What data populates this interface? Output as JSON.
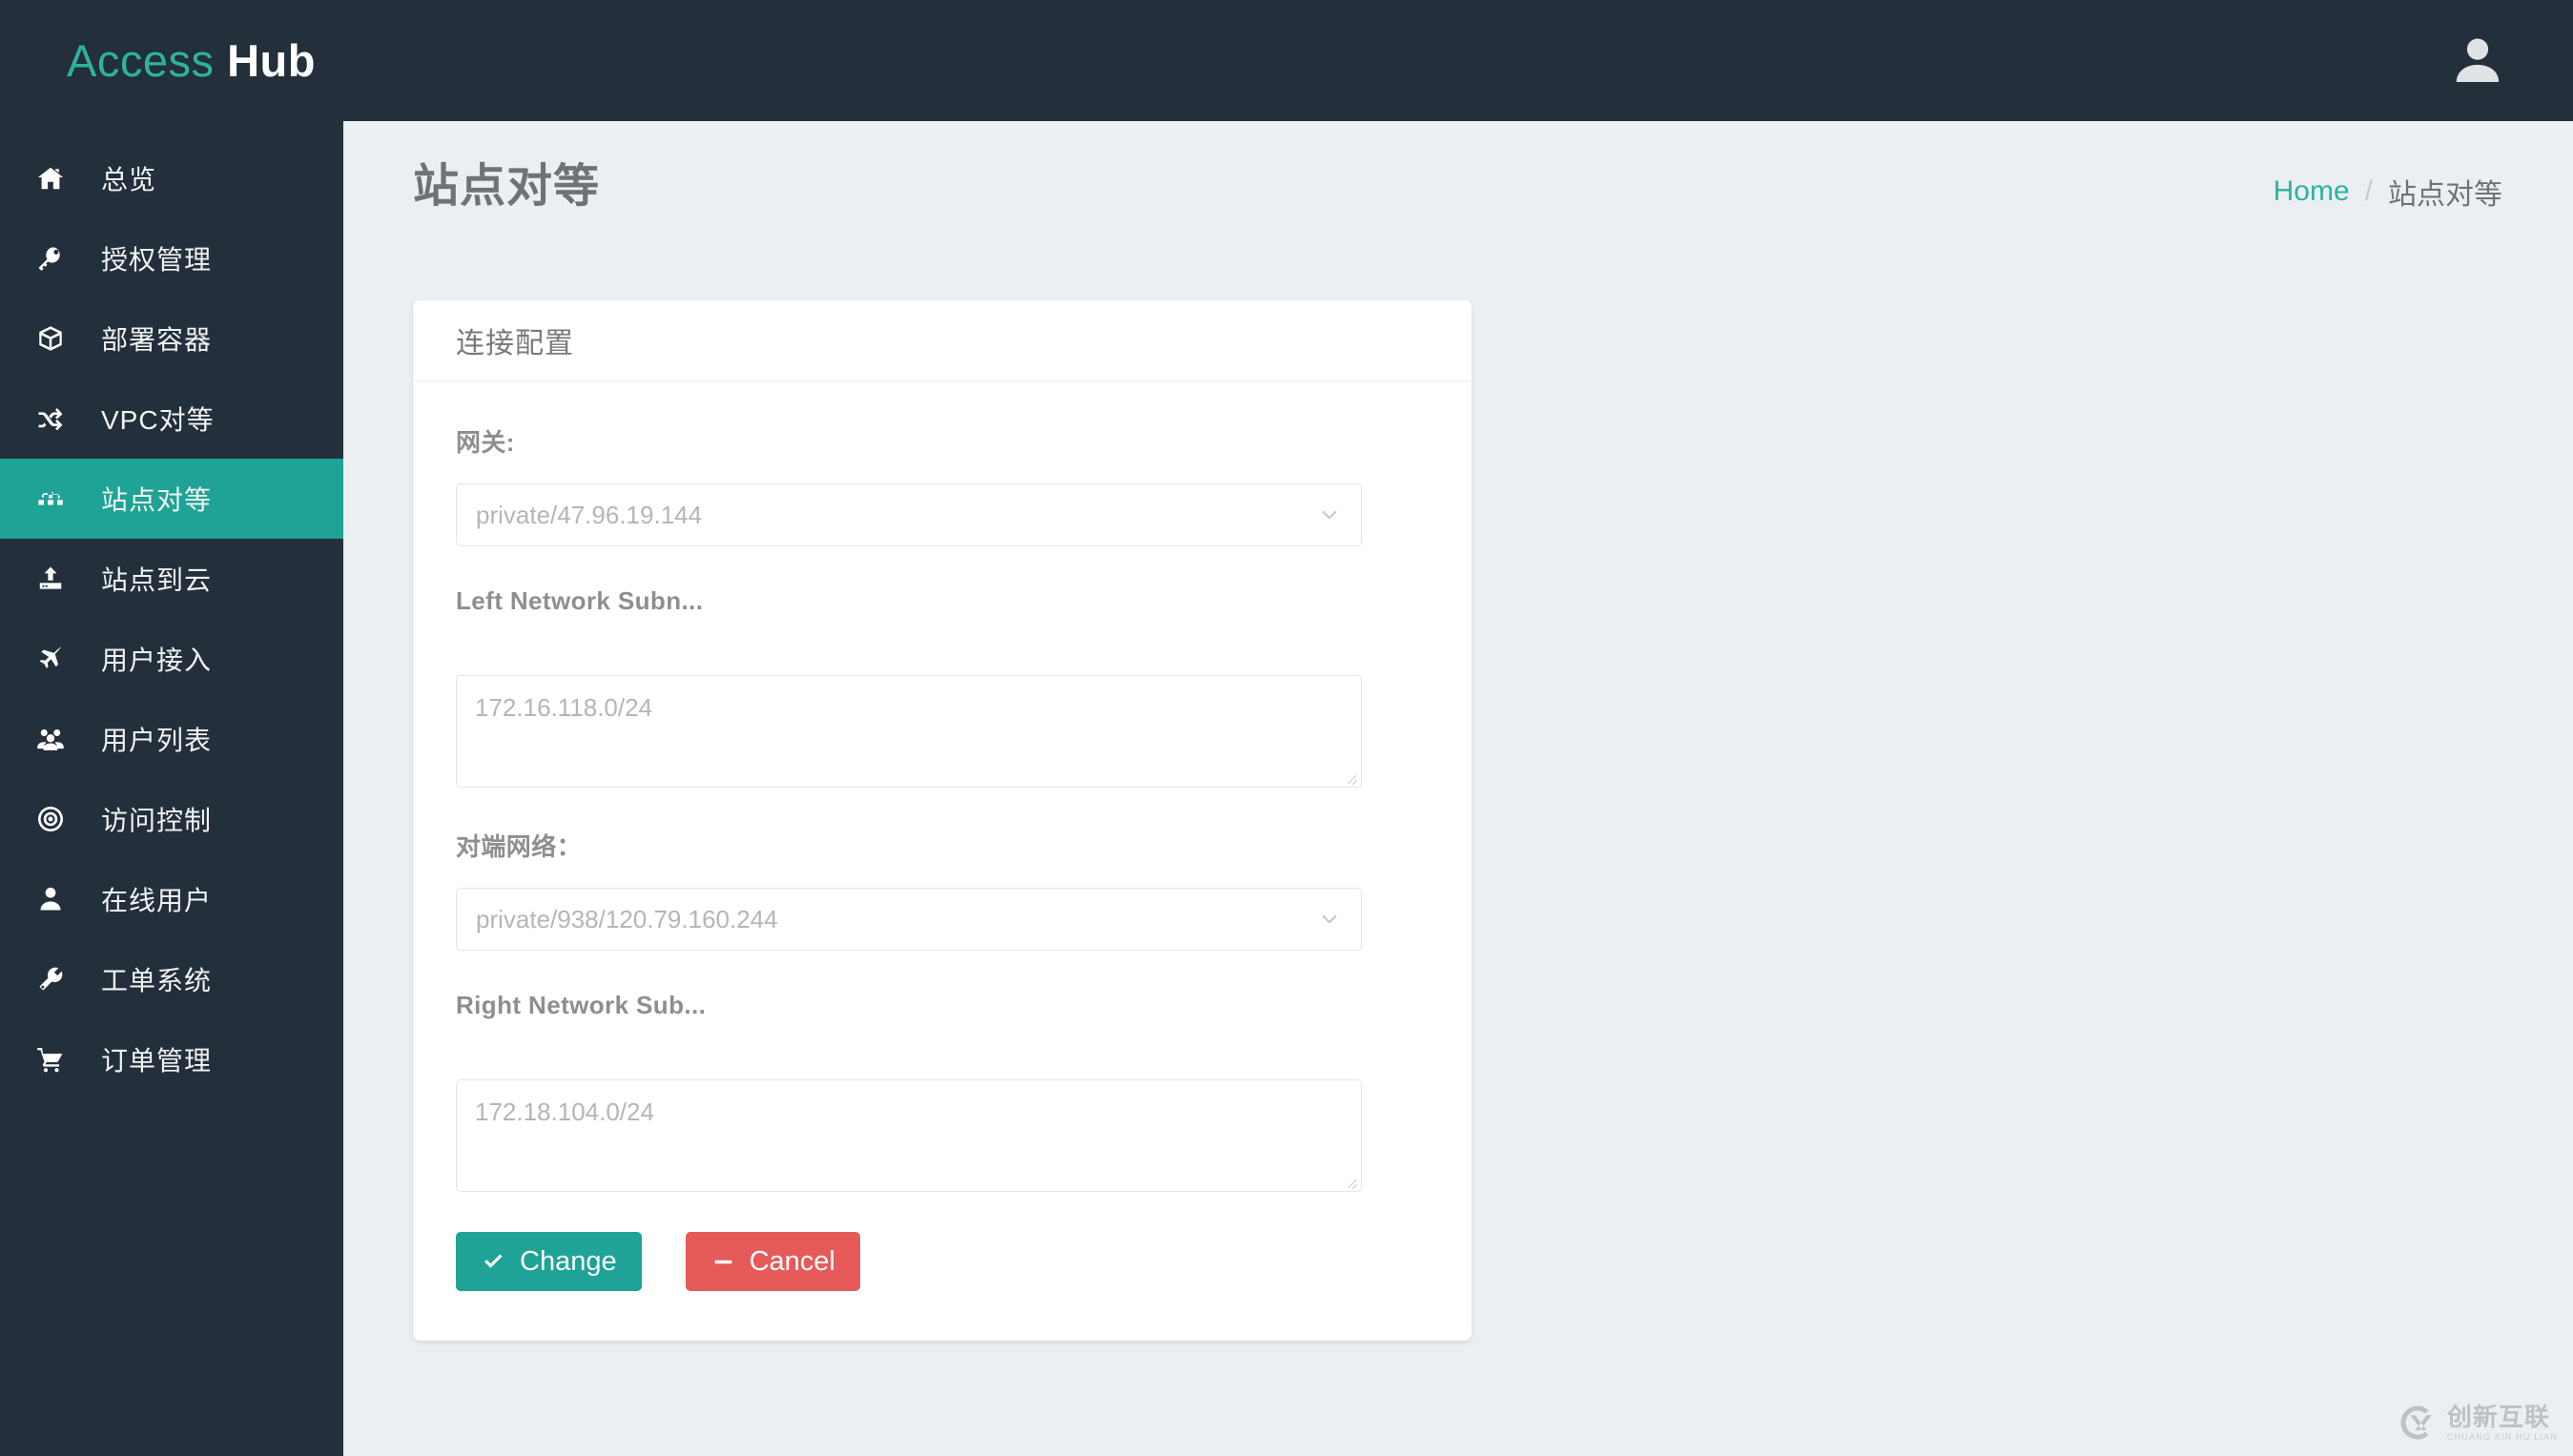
{
  "header": {
    "brand_primary": "Access",
    "brand_secondary": "Hub",
    "avatar_icon": "user-avatar-icon"
  },
  "sidebar": {
    "items": [
      {
        "label": "总览",
        "icon": "home-icon",
        "active": false
      },
      {
        "label": "授权管理",
        "icon": "key-icon",
        "active": false
      },
      {
        "label": "部署容器",
        "icon": "cube-icon",
        "active": false
      },
      {
        "label": "VPC对等",
        "icon": "shuffle-icon",
        "active": false
      },
      {
        "label": "站点对等",
        "icon": "sitemap-icon",
        "active": true
      },
      {
        "label": "站点到云",
        "icon": "upload-icon",
        "active": false
      },
      {
        "label": "用户接入",
        "icon": "plane-icon",
        "active": false
      },
      {
        "label": "用户列表",
        "icon": "users-icon",
        "active": false
      },
      {
        "label": "访问控制",
        "icon": "bullseye-icon",
        "active": false
      },
      {
        "label": "在线用户",
        "icon": "user-icon",
        "active": false
      },
      {
        "label": "工单系统",
        "icon": "wrench-icon",
        "active": false
      },
      {
        "label": "订单管理",
        "icon": "cart-icon",
        "active": false
      }
    ]
  },
  "page": {
    "title": "站点对等",
    "breadcrumb": {
      "home": "Home",
      "separator": "/",
      "current": "站点对等"
    }
  },
  "card": {
    "header_title": "连接配置",
    "gateway": {
      "label": "网关:",
      "value": "private/47.96.19.144",
      "chevron_icon": "chevron-down-icon"
    },
    "left_subnet": {
      "label": "Left Network Subn...",
      "placeholder": "172.16.118.0/24",
      "value": ""
    },
    "peer_network": {
      "label": "对端网络：",
      "value": "private/938/120.79.160.244",
      "chevron_icon": "chevron-down-icon"
    },
    "right_subnet": {
      "label": "Right Network Sub...",
      "placeholder": "172.18.104.0/24",
      "value": ""
    },
    "buttons": {
      "change": {
        "label": "Change",
        "icon": "check-icon",
        "color": "#1ea396"
      },
      "cancel": {
        "label": "Cancel",
        "icon": "minus-icon",
        "color": "#e65a5a"
      }
    }
  },
  "watermark": {
    "cn": "创新互联",
    "en": "CHUANG XIN HU LIAN",
    "logo_icon": "cx-logo-icon"
  },
  "colors": {
    "sidebar_bg": "#232f3b",
    "accent_teal": "#1ea396",
    "brand_teal": "#2cb39e",
    "danger_red": "#e65a5a",
    "page_bg": "#eceff1"
  }
}
